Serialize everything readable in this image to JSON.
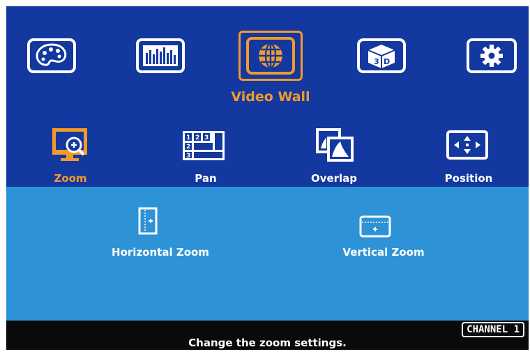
{
  "main_menu": {
    "items": [
      {
        "icon": "palette-icon"
      },
      {
        "icon": "equalizer-icon"
      },
      {
        "icon": "globe-icon",
        "label": "Video Wall",
        "selected": true
      },
      {
        "icon": "3d-icon"
      },
      {
        "icon": "gear-icon"
      }
    ]
  },
  "sub_menu": {
    "items": [
      {
        "icon": "zoom-icon",
        "label": "Zoom",
        "selected": true
      },
      {
        "icon": "pan-grid-icon",
        "label": "Pan",
        "grid_numbers": [
          "1",
          "2",
          "3",
          "2",
          "3"
        ]
      },
      {
        "icon": "overlap-icon",
        "label": "Overlap"
      },
      {
        "icon": "position-icon",
        "label": "Position"
      }
    ]
  },
  "zoom_options": {
    "items": [
      {
        "icon": "horizontal-zoom-icon",
        "label": "Horizontal Zoom"
      },
      {
        "icon": "vertical-zoom-icon",
        "label": "Vertical Zoom"
      }
    ]
  },
  "status": {
    "channel": "CHANNEL 1",
    "help_text": "Change the zoom settings."
  },
  "colors": {
    "accent": "#f39a2b",
    "panel_dark": "#1338a0",
    "panel_light": "#2e93d6",
    "bar": "#0a0a0a"
  }
}
